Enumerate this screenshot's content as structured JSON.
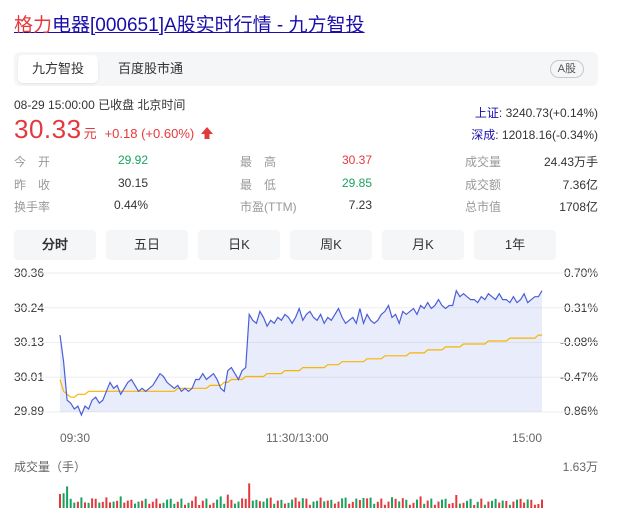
{
  "title": {
    "part1": "格力",
    "part2": "电器[000651]A股实时行情 - 九方智投"
  },
  "tabs": [
    "九方智投",
    "百度股市通"
  ],
  "badge": "A股",
  "status": "08-29 15:00:00 已收盘 北京时间",
  "price": {
    "value": "30.33",
    "unit": "元",
    "change": "+0.18 (+0.60%)",
    "direction": "up"
  },
  "indices": [
    {
      "name": "上证",
      "value": ": 3240.73(+0.14%)"
    },
    {
      "name": "深成",
      "value": ": 12018.16(-0.34%)"
    }
  ],
  "stats": [
    {
      "label": "今　开",
      "value": "29.92",
      "color": "green"
    },
    {
      "label": "最　高",
      "value": "30.37",
      "color": "red"
    },
    {
      "label": "成交量",
      "value": "24.43万手",
      "color": "dark"
    },
    {
      "label": "昨　收",
      "value": "30.15",
      "color": "dark"
    },
    {
      "label": "最　低",
      "value": "29.85",
      "color": "green"
    },
    {
      "label": "成交额",
      "value": "7.36亿",
      "color": "dark"
    },
    {
      "label": "换手率",
      "value": "0.44%",
      "color": "dark"
    },
    {
      "label": "市盈(TTM)",
      "value": "7.23",
      "color": "dark"
    },
    {
      "label": "总市值",
      "value": "1708亿",
      "color": "dark"
    }
  ],
  "range_tabs": [
    "分时",
    "五日",
    "日K",
    "周K",
    "月K",
    "1年"
  ],
  "chart_labels": {
    "y_left": [
      "30.36",
      "30.24",
      "30.13",
      "30.01",
      "29.89"
    ],
    "y_right": [
      "0.70%",
      "0.31%",
      "-0.08%",
      "-0.47%",
      "-0.86%"
    ],
    "x": [
      "09:30",
      "11:30/13:00",
      "15:00"
    ],
    "volume_label": "成交量（手）",
    "volume_max": "1.63万"
  },
  "colors": {
    "up": "#e4393c",
    "down": "#1aa260",
    "price_line": "#4a5fd9",
    "avg_line": "#f7b500",
    "link": "#1a0dab"
  },
  "chart_data": {
    "type": "line",
    "title": "",
    "xlabel": "",
    "ylabel": "",
    "ylim": [
      29.89,
      30.36
    ],
    "x_ticks": [
      "09:30",
      "11:30/13:00",
      "15:00"
    ],
    "series": [
      {
        "values": [
          30.15,
          30.06,
          29.93,
          29.92,
          29.9,
          29.91,
          29.88,
          29.91,
          29.9,
          29.93,
          29.94,
          29.92,
          29.93,
          29.96,
          29.99,
          29.97,
          29.98,
          29.95,
          29.97,
          29.99,
          30.0,
          29.98,
          29.96,
          29.97,
          29.96,
          29.97,
          29.98,
          30.0,
          30.02,
          30.01,
          29.99,
          29.98,
          29.97,
          29.98,
          29.96,
          29.97,
          29.96,
          29.97,
          30.0,
          30.0,
          30.02,
          30.0,
          30.01,
          30.02,
          30.0,
          29.97,
          29.96,
          30.03,
          30.04,
          30.02,
          30.0,
          30.03,
          30.04,
          30.22,
          30.2,
          30.19,
          30.23,
          30.21,
          30.18,
          30.2,
          30.19,
          30.21,
          30.2,
          30.22,
          30.21,
          30.19,
          30.21,
          30.24,
          30.2,
          30.22,
          30.23,
          30.21,
          30.2,
          30.22,
          30.19,
          30.21,
          30.2,
          30.22,
          30.24,
          30.21,
          30.19,
          30.2,
          30.21,
          30.19,
          30.24,
          30.19,
          30.22,
          30.2,
          30.19,
          30.2,
          30.22,
          30.23,
          30.25,
          30.21,
          30.22,
          30.19,
          30.23,
          30.22,
          30.23,
          30.24,
          30.22,
          30.25,
          30.24,
          30.26,
          30.24,
          30.25,
          30.27,
          30.25,
          30.24,
          30.25,
          30.25,
          30.3,
          30.28,
          30.29,
          30.28,
          30.27,
          30.27,
          30.26,
          30.28,
          30.27,
          30.29,
          30.28,
          30.27,
          30.29,
          30.27,
          30.27,
          30.26,
          30.28,
          30.26,
          30.27,
          30.29,
          30.26,
          30.27,
          30.28,
          30.28,
          30.3
        ]
      },
      {
        "values": [
          30.0,
          29.96,
          29.95,
          29.94,
          29.94,
          29.95,
          29.95,
          29.95,
          29.96,
          29.96,
          29.96,
          29.96,
          29.96,
          29.96,
          29.96,
          29.96,
          29.96,
          29.96,
          29.96,
          29.96,
          29.96,
          29.96,
          29.96,
          29.96,
          29.96,
          29.96,
          29.96,
          29.96,
          29.96,
          29.96,
          29.96,
          29.96,
          29.96,
          29.97,
          29.97,
          29.97,
          29.97,
          29.97,
          29.97,
          29.97,
          29.97,
          29.97,
          29.98,
          29.98,
          29.98,
          29.98,
          29.99,
          29.99,
          30.0,
          30.0,
          30.0,
          30.0,
          30.01,
          30.01,
          30.01,
          30.01,
          30.01,
          30.01,
          30.02,
          30.02,
          30.02,
          30.02,
          30.02,
          30.03,
          30.03,
          30.03,
          30.03,
          30.03,
          30.04,
          30.04,
          30.04,
          30.04,
          30.04,
          30.04,
          30.04,
          30.05,
          30.05,
          30.05,
          30.05,
          30.06,
          30.06,
          30.06,
          30.06,
          30.06,
          30.06,
          30.06,
          30.07,
          30.07,
          30.07,
          30.07,
          30.07,
          30.08,
          30.08,
          30.08,
          30.08,
          30.08,
          30.08,
          30.08,
          30.09,
          30.09,
          30.09,
          30.09,
          30.09,
          30.1,
          30.1,
          30.1,
          30.1,
          30.1,
          30.11,
          30.11,
          30.11,
          30.11,
          30.11,
          30.12,
          30.12,
          30.12,
          30.12,
          30.12,
          30.12,
          30.12,
          30.13,
          30.13,
          30.13,
          30.13,
          30.13,
          30.13,
          30.14,
          30.14,
          30.14,
          30.14,
          30.14,
          30.14,
          30.14,
          30.14,
          30.15,
          30.15
        ]
      }
    ]
  }
}
